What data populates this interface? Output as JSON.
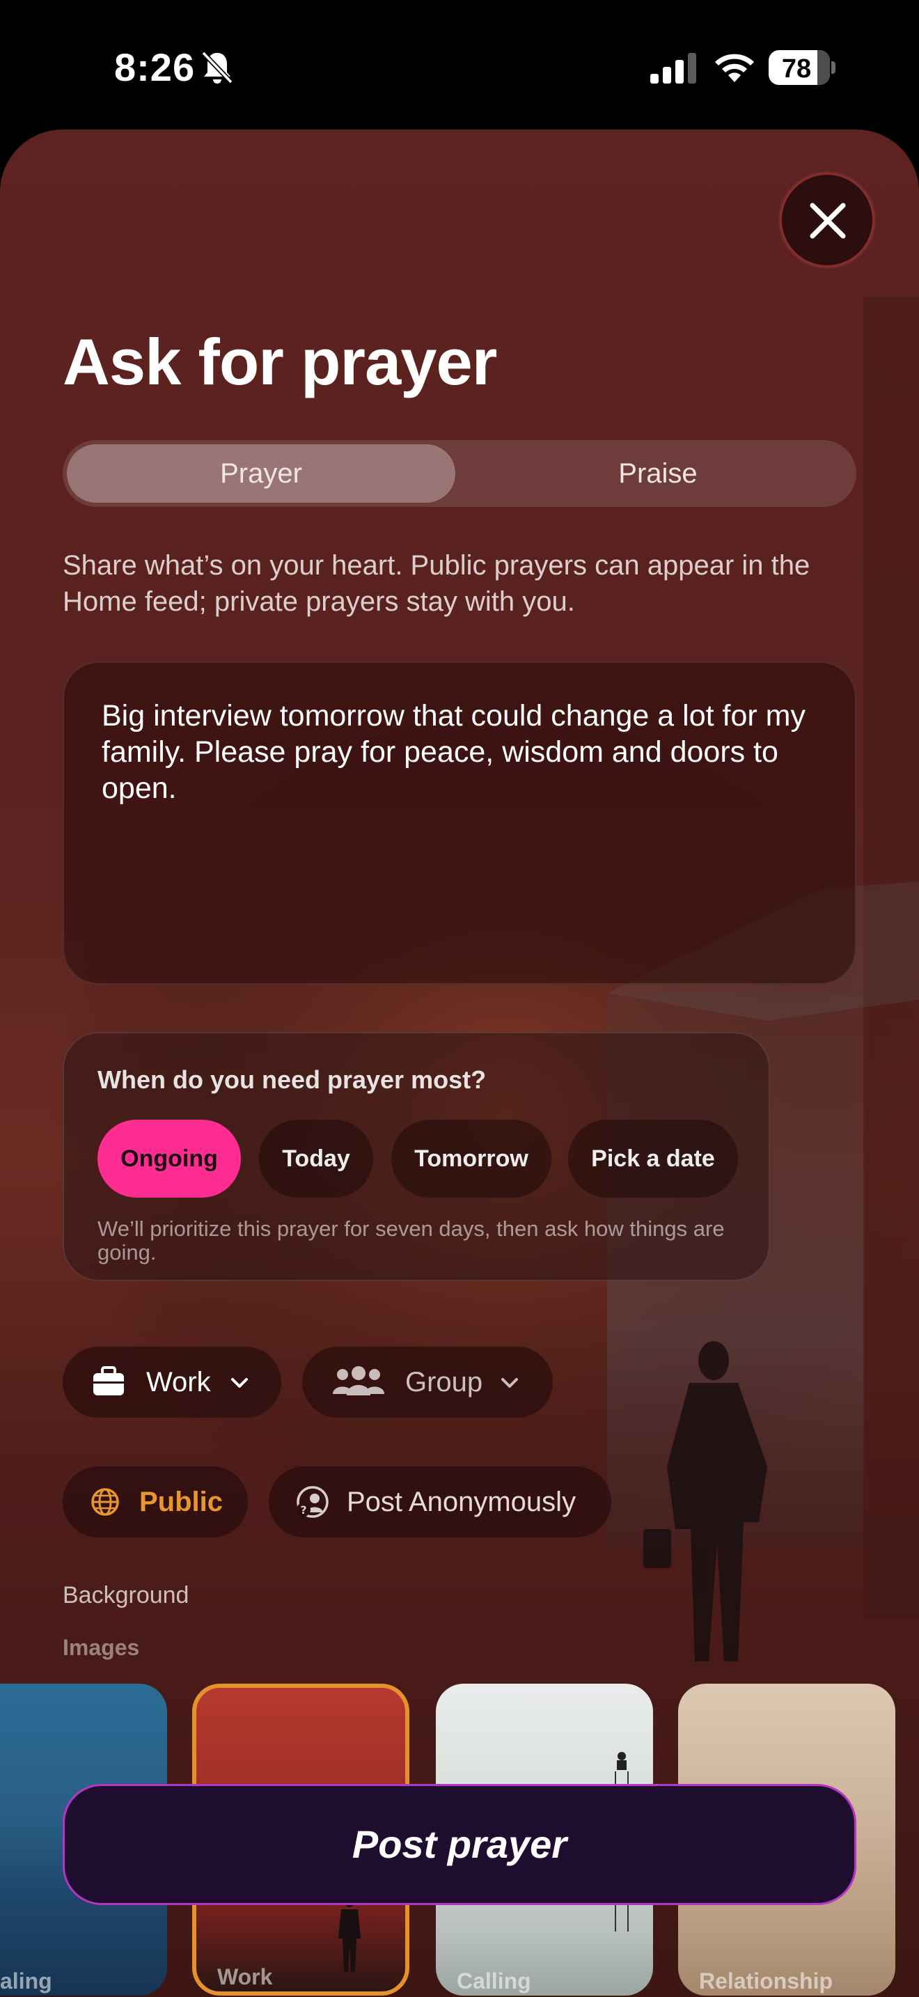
{
  "status_bar": {
    "time": "8:26",
    "battery": "78",
    "icons": [
      "bell-slash-icon",
      "cellular-signal-icon",
      "wifi-icon",
      "battery-icon"
    ]
  },
  "sheet": {
    "title": "Ask for prayer",
    "close_icon": "close-icon",
    "segmented": {
      "options": [
        "Prayer",
        "Praise"
      ],
      "selected": "Prayer"
    },
    "description": "Share what’s on your heart. Public prayers can appear in the Home feed; private prayers stay with you.",
    "prayer_text": "Big interview tomorrow that could change a lot for my family. Please pray for peace, wisdom and doors to open.",
    "when": {
      "question": "When do you need prayer most?",
      "options": [
        "Ongoing",
        "Today",
        "Tomorrow",
        "Pick a date"
      ],
      "selected": "Ongoing",
      "note": "We’ll prioritize this prayer for seven days, then ask how things are going."
    },
    "category": {
      "label": "Work",
      "icon": "briefcase-icon"
    },
    "audience": {
      "label": "Group",
      "icon": "group-icon"
    },
    "visibility": {
      "label": "Public",
      "icon": "globe-icon"
    },
    "anonymous": {
      "label": "Post Anonymously",
      "icon": "anonymous-icon"
    },
    "background_label": "Background",
    "images_label": "Images",
    "images": [
      {
        "label": "aling",
        "selected": false
      },
      {
        "label": "Work",
        "selected": true
      },
      {
        "label": "Calling",
        "selected": false
      },
      {
        "label": "Relationship",
        "selected": false
      }
    ],
    "post_button": "Post prayer"
  },
  "colors": {
    "accent_pink": "#ff2d92",
    "accent_orange": "#e5912c",
    "post_border": "#b535c4",
    "sheet_bg": "#5e2320"
  }
}
